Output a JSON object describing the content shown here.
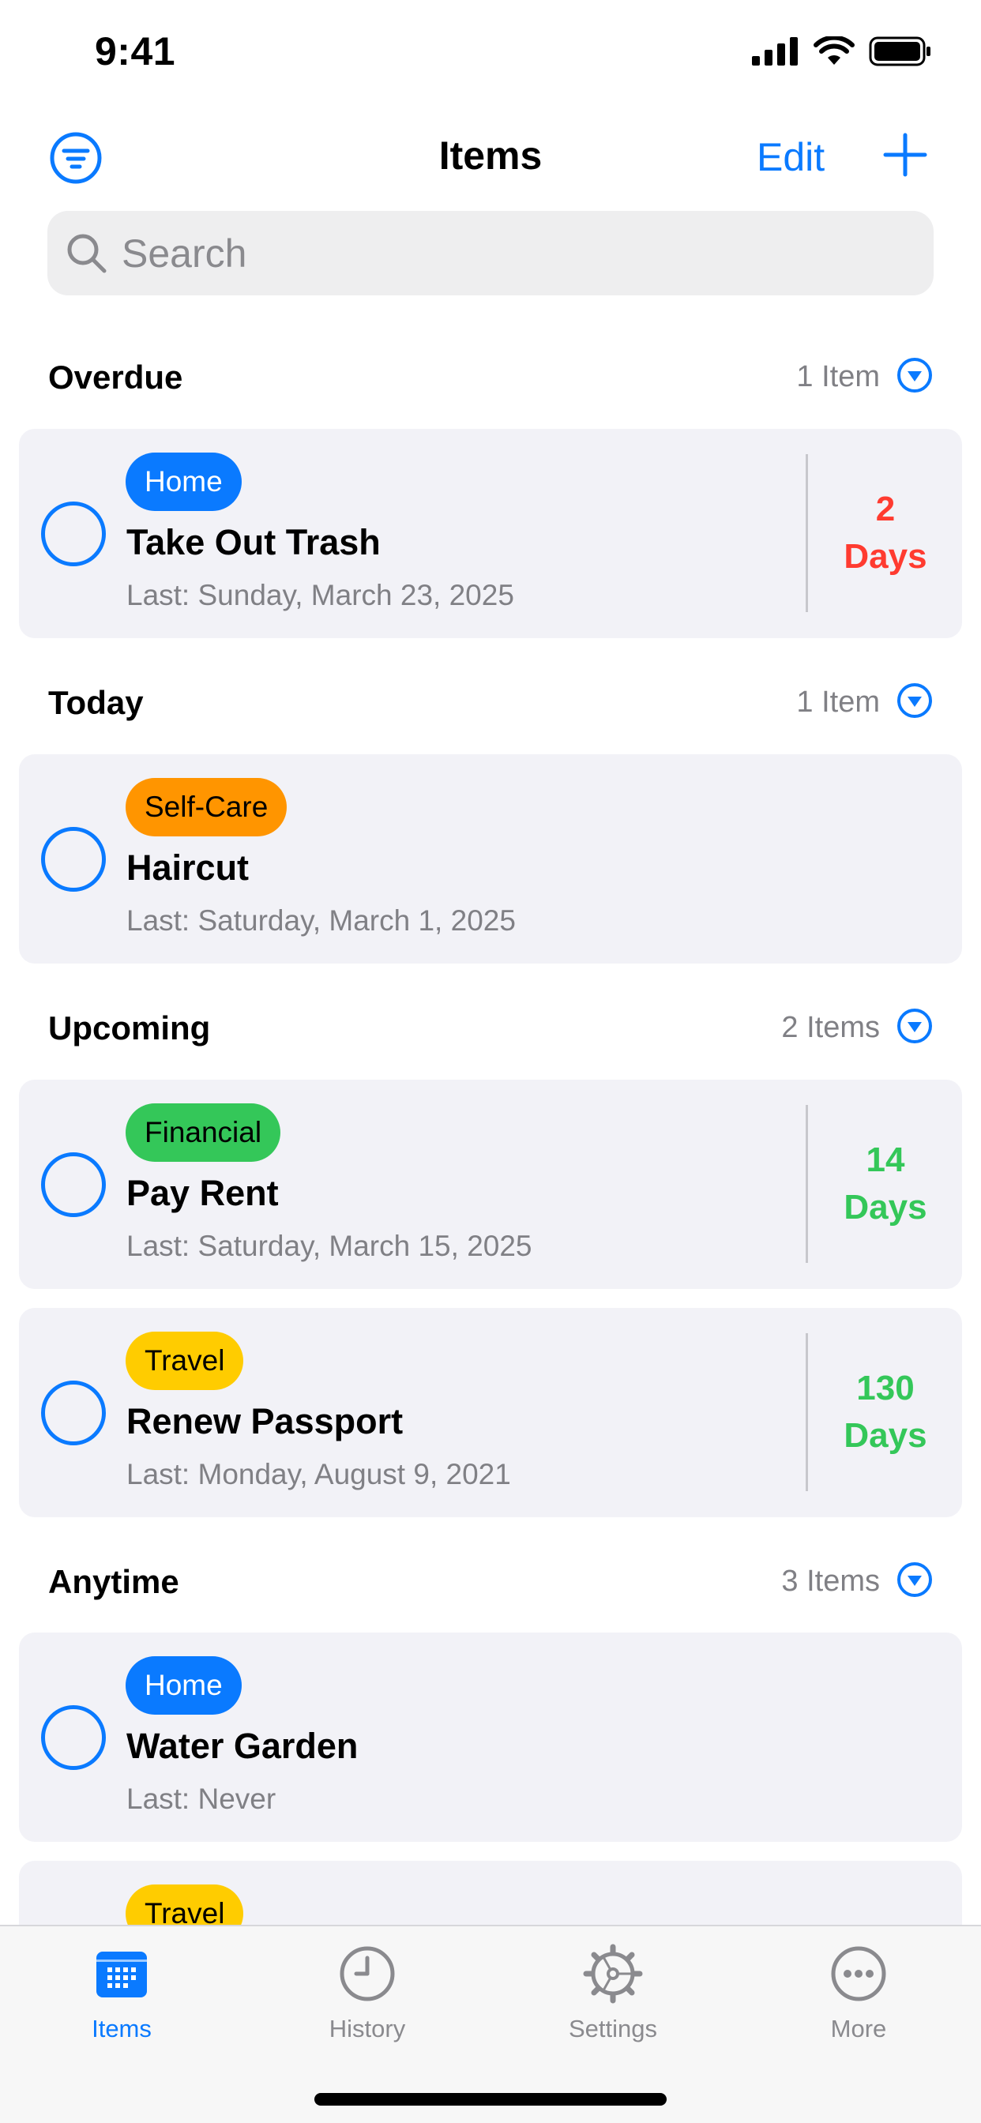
{
  "status": {
    "time": "9:41"
  },
  "nav": {
    "title": "Items",
    "edit_label": "Edit"
  },
  "search": {
    "placeholder": "Search"
  },
  "colors": {
    "accent": "#0A7AFF",
    "overdue": "#FF3B30",
    "upcoming": "#34C759"
  },
  "sections": [
    {
      "title": "Overdue",
      "count": "1 Item",
      "items": [
        {
          "tag": "Home",
          "tag_color": "#0A7AFF",
          "title": "Take Out Trash",
          "last": "Last: Sunday, March 23, 2025",
          "days_num": "2",
          "days_unit": "Days"
        }
      ]
    },
    {
      "title": "Today",
      "count": "1 Item",
      "items": [
        {
          "tag": "Self-Care",
          "tag_color": "#FF9500",
          "title": "Haircut",
          "last": "Last: Saturday, March 1, 2025"
        }
      ]
    },
    {
      "title": "Upcoming",
      "count": "2 Items",
      "items": [
        {
          "tag": "Financial",
          "tag_color": "#34C759",
          "title": "Pay Rent",
          "last": "Last: Saturday, March 15, 2025",
          "days_num": "14",
          "days_unit": "Days"
        },
        {
          "tag": "Travel",
          "tag_color": "#FFCC00",
          "title": "Renew Passport",
          "last": "Last: Monday, August 9, 2021",
          "days_num": "130",
          "days_unit": "Days"
        }
      ]
    },
    {
      "title": "Anytime",
      "count": "3 Items",
      "items": [
        {
          "tag": "Home",
          "tag_color": "#0A7AFF",
          "title": "Water Garden",
          "last": "Last: Never"
        },
        {
          "tag": "Travel",
          "tag_color": "#FFCC00"
        }
      ]
    }
  ],
  "tabs": [
    {
      "label": "Items",
      "icon": "calendar-icon",
      "active": true
    },
    {
      "label": "History",
      "icon": "clock-icon"
    },
    {
      "label": "Settings",
      "icon": "gear-icon"
    },
    {
      "label": "More",
      "icon": "ellipsis-circle-icon"
    }
  ]
}
